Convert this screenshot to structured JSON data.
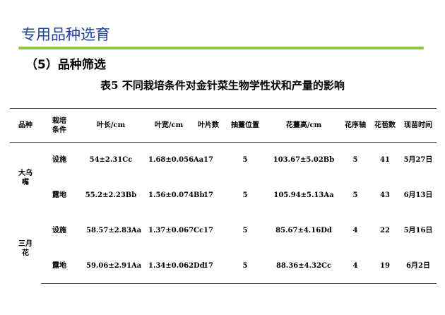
{
  "slide": {
    "title": "专用品种选育",
    "subsection": "（5）品种筛选",
    "caption": "表5 不同栽培条件对金针菜生物学性状和产量的影响"
  },
  "table": {
    "headers": [
      "品种",
      "栽培条件",
      "叶长/cm",
      "叶宽/cm",
      "叶片数",
      "抽薹位置",
      "花薹高/cm",
      "花序轴",
      "花苞数",
      "现苗时间"
    ],
    "varieties": [
      {
        "name": "大乌嘴",
        "rows": [
          {
            "condition": "设施",
            "leaf_length": "54±2.31Cc",
            "leaf_width": "1.68±0.056Aa",
            "leaf_count": "17",
            "bolting_position": "5",
            "scape_height": "103.67±5.02Bb",
            "inflorescence_axis": "5",
            "bud_count": "41",
            "emergence_time": "5月27日"
          },
          {
            "condition": "露地",
            "leaf_length": "55.2±2.23Bb",
            "leaf_width": "1.56±0.074Bb",
            "leaf_count": "17",
            "bolting_position": "5",
            "scape_height": "105.94±5.13Aa",
            "inflorescence_axis": "5",
            "bud_count": "43",
            "emergence_time": "6月13日"
          }
        ]
      },
      {
        "name": "三月花",
        "rows": [
          {
            "condition": "设施",
            "leaf_length": "58.57±2.83Aa",
            "leaf_width": "1.37±0.067Cc",
            "leaf_count": "17",
            "bolting_position": "5",
            "scape_height": "85.67±4.16Dd",
            "inflorescence_axis": "4",
            "bud_count": "22",
            "emergence_time": "5月16日"
          },
          {
            "condition": "露地",
            "leaf_length": "59.06±2.91Aa",
            "leaf_width": "1.34±0.062Dd",
            "leaf_count": "17",
            "bolting_position": "5",
            "scape_height": "88.36±4.32Cc",
            "inflorescence_axis": "4",
            "bud_count": "19",
            "emergence_time": "6月2日"
          }
        ]
      }
    ]
  }
}
